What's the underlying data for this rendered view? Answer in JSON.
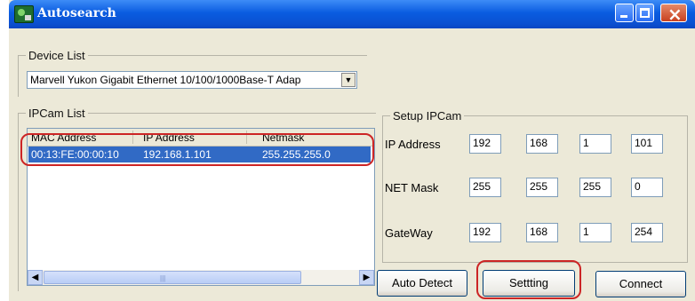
{
  "window": {
    "title": "Autosearch"
  },
  "device_list": {
    "legend": "Device List",
    "selected": "Marvell Yukon Gigabit Ethernet 10/100/1000Base-T Adap"
  },
  "ipcam_list": {
    "legend": "IPCam List",
    "columns": [
      "MAC Address",
      "IP Address",
      "Netmask"
    ],
    "rows": [
      {
        "mac": "00:13:FE:00:00:10",
        "ip": "192.168.1.101",
        "netmask": "255.255.255.0"
      }
    ],
    "scroll_grip": "|||"
  },
  "setup": {
    "legend": "Setup IPCam",
    "ip_label": "IP Address",
    "ip": [
      "192",
      "168",
      "1",
      "101"
    ],
    "mask_label": "NET Mask",
    "mask": [
      "255",
      "255",
      "255",
      "0"
    ],
    "gateway_label": "GateWay",
    "gateway": [
      "192",
      "168",
      "1",
      "254"
    ]
  },
  "buttons": {
    "auto_detect": "Auto Detect",
    "setting": "Settting",
    "connect": "Connect"
  },
  "icons": {
    "close": "×",
    "dropdown": "▼",
    "left": "◀",
    "right": "▶"
  },
  "colors": {
    "selection": "#316ac5",
    "annotation": "#cc2525",
    "titlebar": "#0a5ce0"
  }
}
